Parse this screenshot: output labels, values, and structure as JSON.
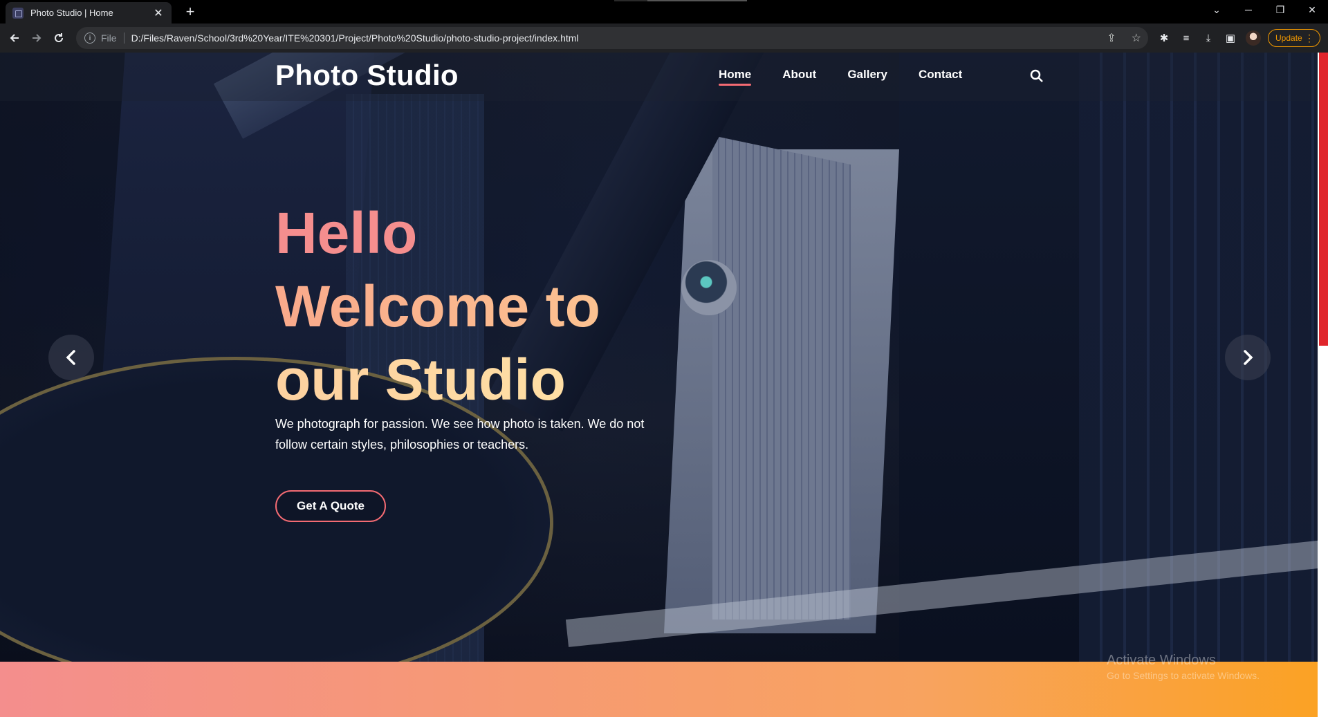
{
  "browser": {
    "tab_title": "Photo Studio | Home",
    "scheme_label": "File",
    "url": "D:/Files/Raven/School/3rd%20Year/ITE%20301/Project/Photo%20Studio/photo-studio-project/index.html",
    "update_label": "Update",
    "accent_color": "#f29900"
  },
  "site": {
    "logo": "Photo Studio",
    "nav": [
      {
        "label": "Home",
        "active": true
      },
      {
        "label": "About",
        "active": false
      },
      {
        "label": "Gallery",
        "active": false
      },
      {
        "label": "Contact",
        "active": false
      }
    ]
  },
  "hero": {
    "headline": [
      "Hello",
      "Welcome to",
      "our Studio"
    ],
    "subtext": "We photograph for passion. We see how photo is taken. We do not follow certain styles, philosophies or teachers.",
    "cta_label": "Get A Quote",
    "accent_color": "#f46b73"
  },
  "os_watermark": {
    "line1": "Activate Windows",
    "line2": "Go to Settings to activate Windows."
  },
  "icons": [
    "favicon-icon",
    "close-tab-icon",
    "new-tab-icon",
    "back-icon",
    "forward-icon",
    "reload-icon",
    "info-icon",
    "share-icon",
    "star-icon",
    "extensions-icon",
    "reading-list-icon",
    "download-icon",
    "side-panel-icon",
    "search-icon",
    "chevron-left-icon",
    "chevron-right-icon"
  ]
}
